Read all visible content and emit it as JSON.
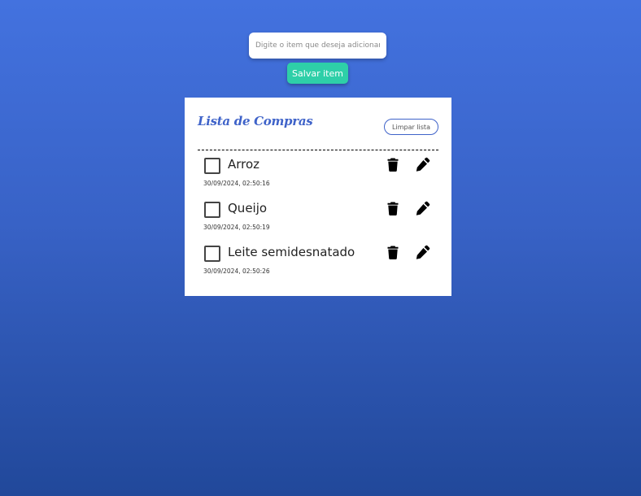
{
  "form": {
    "input_placeholder": "Digite o item que deseja adicionar",
    "input_value": "",
    "save_label": "Salvar item"
  },
  "list": {
    "title": "Lista de Compras",
    "clear_label": "Limpar lista",
    "items": [
      {
        "name": "Arroz",
        "date": "30/09/2024, 02:50:16",
        "checked": false
      },
      {
        "name": "Queijo",
        "date": "30/09/2024, 02:50:19",
        "checked": false
      },
      {
        "name": "Leite semidesnatado",
        "date": "30/09/2024, 02:50:26",
        "checked": false
      }
    ]
  },
  "icons": {
    "delete": "trash-icon",
    "edit": "pencil-icon"
  },
  "colors": {
    "background_top": "#4372df",
    "background_bottom": "#21489a",
    "accent": "#3f63c9",
    "save_button": "#2ecfa8"
  }
}
